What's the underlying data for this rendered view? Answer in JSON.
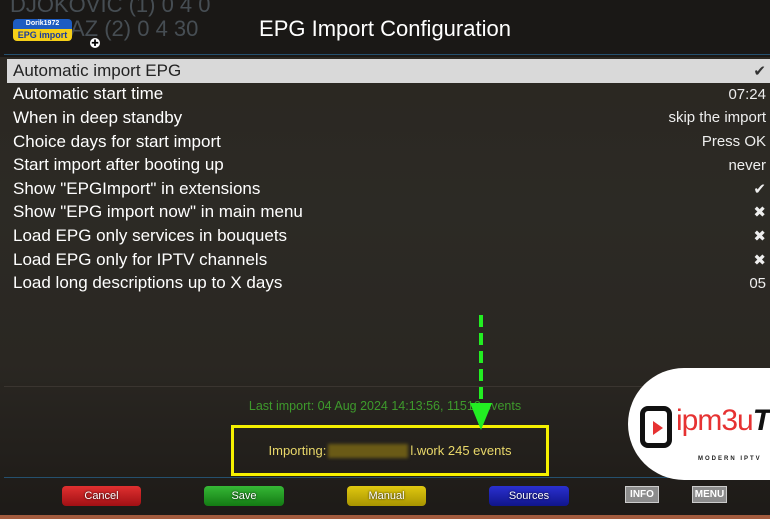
{
  "background_scoreboard": {
    "row1": "DJOKOVIC (1)  0  4  0",
    "row2": "AZ (2)  0  4  30"
  },
  "logo": {
    "line1": "Dorik1972",
    "line2": "EPG import"
  },
  "header": {
    "title": "EPG Import Configuration"
  },
  "settings": [
    {
      "label": "Automatic import EPG",
      "value": "✔",
      "selected": true
    },
    {
      "label": "Automatic start time",
      "value": "07:24"
    },
    {
      "label": "When in deep standby",
      "value": "skip the import"
    },
    {
      "label": "Choice days for start import",
      "value": "Press OK"
    },
    {
      "label": "Start import after booting up",
      "value": "never"
    },
    {
      "label": "Show \"EPGImport\" in extensions",
      "value": "✔"
    },
    {
      "label": "Show \"EPG import now\" in main menu",
      "value": "✖"
    },
    {
      "label": "Load EPG only services in bouquets",
      "value": "✖"
    },
    {
      "label": "Load EPG only for IPTV channels",
      "value": "✖"
    },
    {
      "label": "Load long descriptions up to X days",
      "value": "05"
    }
  ],
  "status": {
    "last_import": "Last import: 04 Aug 2024 14:13:56, 11512 events"
  },
  "importing": {
    "prefix": "Importing:",
    "suffix": "l.work 245 events"
  },
  "buttons": {
    "cancel": "Cancel",
    "save": "Save",
    "manual": "Manual",
    "sources": "Sources",
    "info": "INFO",
    "menu": "MENU"
  },
  "watermark": {
    "name": "ipm3u",
    "name_suffix": "Tv",
    "tagline": "MODERN IPTV"
  },
  "colors": {
    "red": "#c0161a",
    "green": "#1f9a1f",
    "yellow": "#c9b400",
    "blue": "#1a1fb0",
    "highlight": "#d9d9d9",
    "arrow": "#22ee22",
    "import_border": "#f5f000"
  }
}
